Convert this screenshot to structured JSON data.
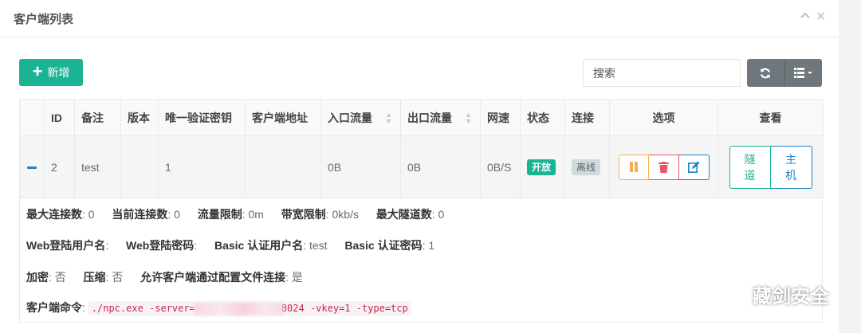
{
  "panel": {
    "title": "客户端列表"
  },
  "toolbar": {
    "add_label": "新增",
    "search_placeholder": "搜索"
  },
  "table": {
    "headers": {
      "id": "ID",
      "remark": "备注",
      "version": "版本",
      "vkey": "唯一验证密钥",
      "addr": "客户端地址",
      "inflow": "入口流量",
      "outflow": "出口流量",
      "speed": "网速",
      "status": "状态",
      "conn": "连接",
      "ops": "选项",
      "view": "查看"
    },
    "row": {
      "id": "2",
      "remark": "test",
      "version": "",
      "vkey": "1",
      "addr": "",
      "inflow": "0B",
      "outflow": "0B",
      "speed": "0B/S",
      "status": "开放",
      "conn": "离线",
      "view_tunnel": "隧道",
      "view_host": "主机"
    }
  },
  "detail": {
    "max_conn_label": "最大连接数",
    "max_conn": "0",
    "cur_conn_label": "当前连接数",
    "cur_conn": "0",
    "flow_limit_label": "流量限制",
    "flow_limit": "0m",
    "rate_limit_label": "带宽限制",
    "rate_limit": "0kb/s",
    "max_tunnel_label": "最大隧道数",
    "max_tunnel": "0",
    "web_user_label": "Web登陆用户名",
    "web_user": "",
    "web_pass_label": "Web登陆密码",
    "web_pass": "",
    "basic_user_label": "Basic 认证用户名",
    "basic_user": "test",
    "basic_pass_label": "Basic 认证密码",
    "basic_pass": "1",
    "crypt_label": "加密",
    "crypt": "否",
    "compress_label": "压缩",
    "compress": "否",
    "config_conn_label": "允许客户端通过配置文件连接",
    "config_conn": "是",
    "cmd_label": "客户端命令",
    "cmd_prefix": "./npc.exe -server=",
    "cmd_suffix": "8024 -vkey=1 -type=tcp"
  },
  "watermark": {
    "text": "藏剑安全"
  },
  "colors": {
    "primary": "#1ab394",
    "info": "#1c84c6",
    "warning": "#f8ac59",
    "danger": "#ed5565",
    "toolbar_gray": "#6f767c"
  },
  "icons": {
    "collapse": "chevron-up-icon",
    "close": "close-icon",
    "add": "plus-icon",
    "refresh": "refresh-icon",
    "columns": "columns-list-icon",
    "expand": "minus-icon",
    "pause": "pause-icon",
    "delete": "trash-icon",
    "edit": "edit-icon",
    "wechat": "wechat-icon"
  }
}
